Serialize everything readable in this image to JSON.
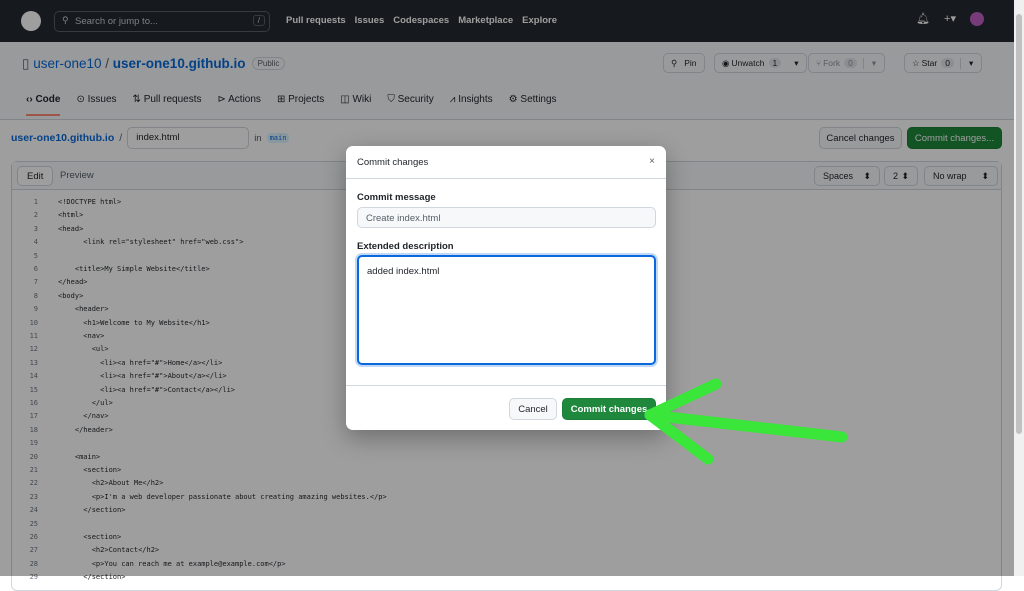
{
  "topnav": {
    "search_placeholder": "Search or jump to...",
    "search_shortcut": "/",
    "links": [
      "Pull requests",
      "Issues",
      "Codespaces",
      "Marketplace",
      "Explore"
    ],
    "plus": "+▾"
  },
  "repo": {
    "owner": "user-one10",
    "separator": "/",
    "name": "user-one10.github.io",
    "visibility": "Public",
    "pin": "Pin",
    "watch": "Unwatch",
    "watch_count": "1",
    "fork": "Fork",
    "fork_count": "0",
    "star": "Star",
    "star_count": "0"
  },
  "tabs": [
    "Code",
    "Issues",
    "Pull requests",
    "Actions",
    "Projects",
    "Wiki",
    "Security",
    "Insights",
    "Settings"
  ],
  "path": {
    "repo": "user-one10.github.io",
    "sep": "/",
    "filename": "index.html",
    "in": "in",
    "branch": "main"
  },
  "actions": {
    "cancel": "Cancel changes",
    "commit": "Commit changes..."
  },
  "editor": {
    "tab_edit": "Edit",
    "tab_preview": "Preview",
    "indent_mode": "Spaces",
    "indent_size": "2",
    "wrap": "No wrap",
    "lines": [
      "<!DOCTYPE html>",
      "<html>",
      "<head>",
      "      <link rel=\"stylesheet\" href=\"web.css\">",
      "",
      "    <title>My Simple Website</title>",
      "</head>",
      "<body>",
      "    <header>",
      "      <h1>Welcome to My Website</h1>",
      "      <nav>",
      "        <ul>",
      "          <li><a href=\"#\">Home</a></li>",
      "          <li><a href=\"#\">About</a></li>",
      "          <li><a href=\"#\">Contact</a></li>",
      "        </ul>",
      "      </nav>",
      "    </header>",
      "",
      "    <main>",
      "      <section>",
      "        <h2>About Me</h2>",
      "        <p>I'm a web developer passionate about creating amazing websites.</p>",
      "      </section>",
      "",
      "      <section>",
      "        <h2>Contact</h2>",
      "        <p>You can reach me at example@example.com</p>",
      "      </section>"
    ]
  },
  "modal": {
    "title": "Commit changes",
    "close": "×",
    "message_label": "Commit message",
    "message_value": "Create index.html",
    "desc_label": "Extended description",
    "desc_value": "added index.html",
    "cancel": "Cancel",
    "commit": "Commit changes"
  },
  "colors": {
    "accent": "#1f883d",
    "arrow": "#39e639"
  }
}
